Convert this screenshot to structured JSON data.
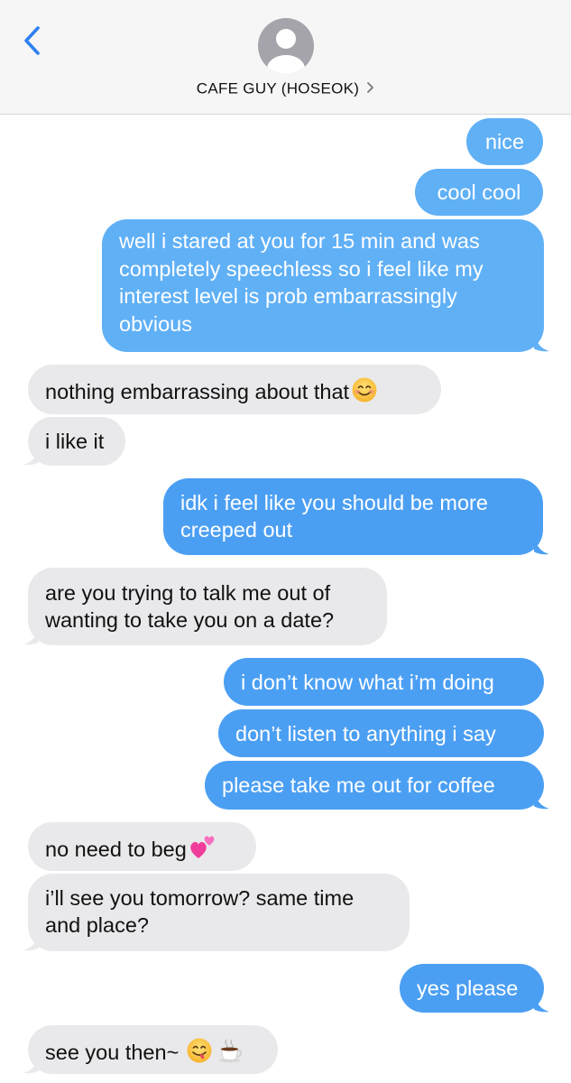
{
  "header": {
    "contact_name": "CAFE GUY (HOSEOK)",
    "back_icon": "chevron-left-icon",
    "avatar_icon": "person-silhouette-icon",
    "details_icon": "chevron-right-icon"
  },
  "colors": {
    "outgoing_bubble": "#4b9ff3",
    "outgoing_bubble_top": "#60b0f6",
    "incoming_bubble": "#e9e9eb",
    "back_accent": "#2f7ff0",
    "header_bg": "#f6f6f6"
  },
  "messages": [
    {
      "direction": "out",
      "text": "nice"
    },
    {
      "direction": "out",
      "text": "cool cool"
    },
    {
      "direction": "out",
      "text": "well i stared at you for 15 min and was completely speechless so i feel like my interest level is prob embarrassingly obvious"
    },
    {
      "direction": "in",
      "text": "nothing embarrassing about that",
      "emoji": "smiling-face-emoji"
    },
    {
      "direction": "in",
      "text": "i like it"
    },
    {
      "direction": "out",
      "text": "idk i feel like you should be more creeped out"
    },
    {
      "direction": "in",
      "text": "are you trying to talk me out of wanting to take you on a date?"
    },
    {
      "direction": "out",
      "text": "i don’t know what i’m doing"
    },
    {
      "direction": "out",
      "text": "don’t listen to anything i say"
    },
    {
      "direction": "out",
      "text": "please take me out for coffee"
    },
    {
      "direction": "in",
      "text": "no need to beg",
      "emoji": "two-hearts-emoji"
    },
    {
      "direction": "in",
      "text": "i’ll see you tomorrow? same time and place?"
    },
    {
      "direction": "out",
      "text": "yes please"
    },
    {
      "direction": "in",
      "text": "see you then~",
      "emoji": "yum-face-and-coffee-emoji"
    }
  ]
}
